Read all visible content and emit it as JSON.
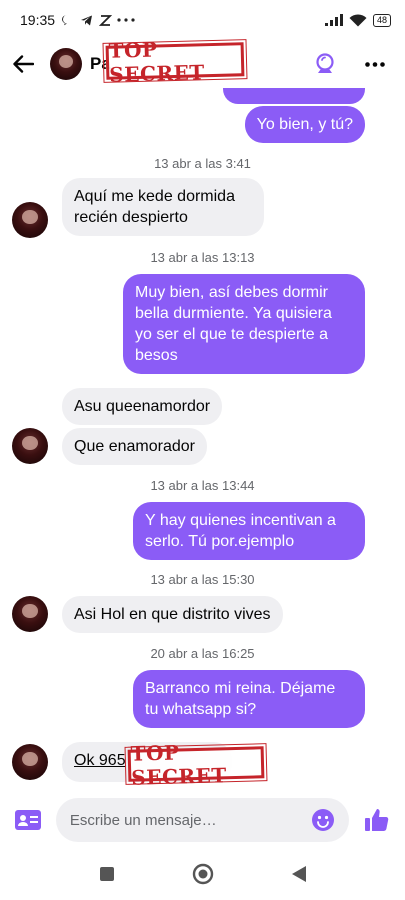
{
  "status_bar": {
    "time": "19:35",
    "battery": "48"
  },
  "header": {
    "contact_name": "Pa",
    "redaction_stamp": "TOP SECRET"
  },
  "messages": [
    {
      "type": "out",
      "text": "Yo bien, y tú?"
    },
    {
      "type": "timestamp",
      "text": "13 abr a las 3:41"
    },
    {
      "type": "in",
      "text": "Aquí me kede dormida recién despierto"
    },
    {
      "type": "timestamp",
      "text": "13 abr a las 13:13"
    },
    {
      "type": "out",
      "text": "Muy bien, así debes dormir bella durmiente. Ya quisiera yo ser el que te despierte a besos"
    },
    {
      "type": "in",
      "text": "Asu queenamordor"
    },
    {
      "type": "in",
      "text": "Que enamorador"
    },
    {
      "type": "timestamp",
      "text": "13 abr a las 13:44"
    },
    {
      "type": "out",
      "text": "Y hay quienes incentivan a serlo. Tú por.ejemplo"
    },
    {
      "type": "timestamp",
      "text": "13 abr a las 15:30"
    },
    {
      "type": "in",
      "text": "Asi Hol en que distrito vives"
    },
    {
      "type": "timestamp",
      "text": "20 abr a las 16:25"
    },
    {
      "type": "out",
      "text": "Barranco mi reina. Déjame tu whatsapp si?"
    },
    {
      "type": "in",
      "text": "Ok 965"
    }
  ],
  "composer": {
    "placeholder": "Escribe un mensaje…"
  },
  "colors": {
    "accent": "#8b5cf6",
    "incoming_bubble": "#efeff2",
    "stamp": "#c5242a"
  }
}
